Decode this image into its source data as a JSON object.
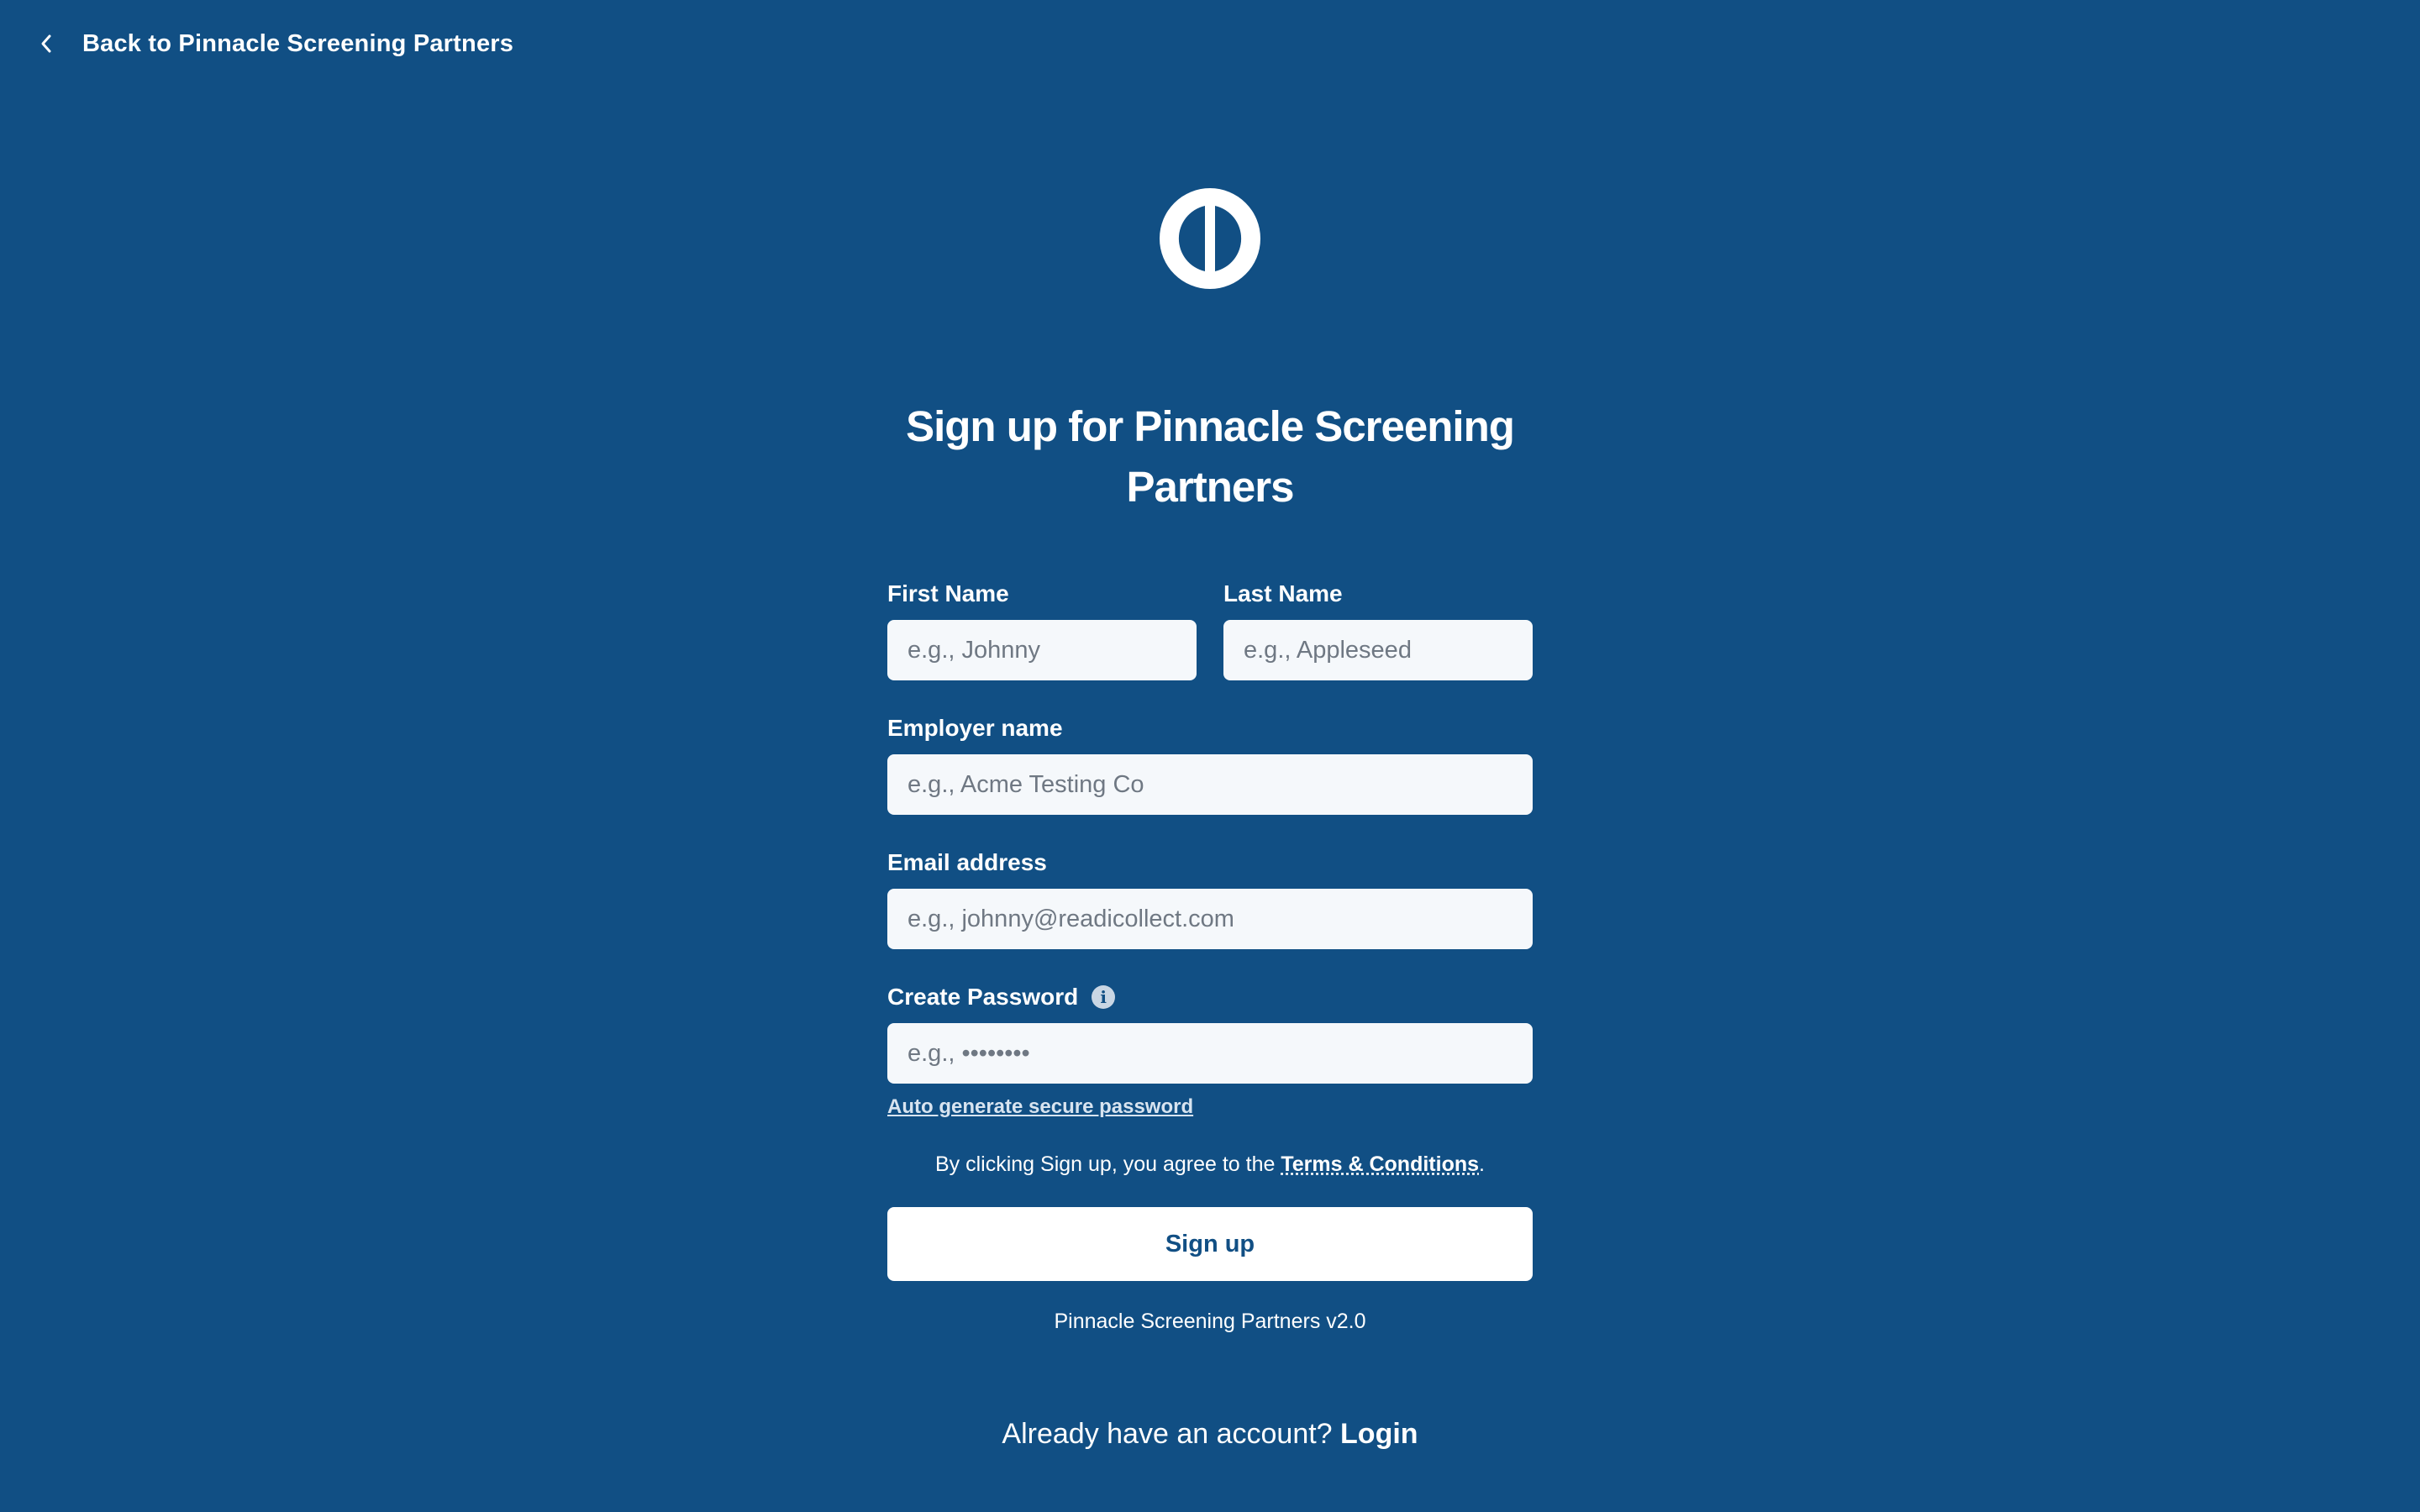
{
  "header": {
    "back_label": "Back to Pinnacle Screening Partners"
  },
  "title": "Sign up for Pinnacle Screening Partners",
  "form": {
    "first_name": {
      "label": "First Name",
      "placeholder": "e.g., Johnny",
      "value": ""
    },
    "last_name": {
      "label": "Last Name",
      "placeholder": "e.g., Appleseed",
      "value": ""
    },
    "employer": {
      "label": "Employer name",
      "placeholder": "e.g., Acme Testing Co",
      "value": ""
    },
    "email": {
      "label": "Email address",
      "placeholder": "e.g., johnny@readicollect.com",
      "value": ""
    },
    "password": {
      "label": "Create Password",
      "placeholder": "e.g., ••••••••",
      "value": "",
      "info_icon": "info-icon"
    },
    "autogen_label": "Auto generate secure password"
  },
  "terms": {
    "prefix": "By clicking Sign up, you agree to the ",
    "link": "Terms & Conditions",
    "suffix": "."
  },
  "signup_button": "Sign up",
  "version": "Pinnacle Screening Partners v2.0",
  "login": {
    "prompt": "Already have an account? ",
    "link": "Login"
  },
  "colors": {
    "background": "#114f84",
    "input_background": "#f5f8fb",
    "button_background": "#ffffff",
    "button_text": "#114f84"
  },
  "icons": {
    "back": "chevron-left-icon",
    "logo": "logo-icon",
    "info": "info-icon"
  }
}
